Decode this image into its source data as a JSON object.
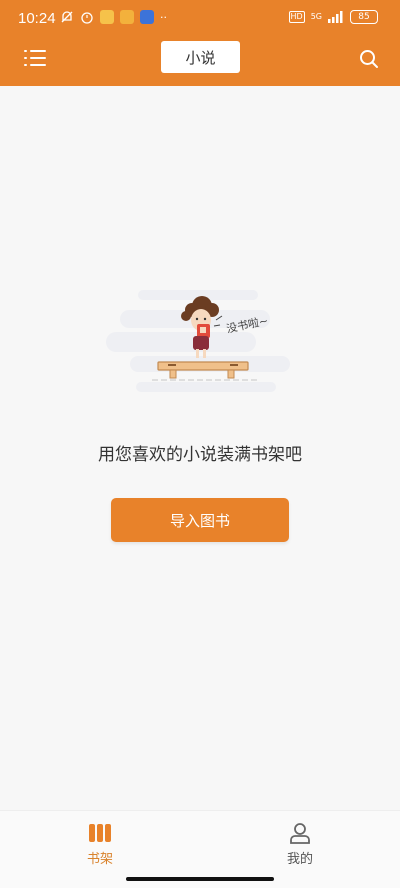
{
  "status_bar": {
    "time": "10:24",
    "network": "5G",
    "hd": "HD",
    "battery": "85"
  },
  "app_bar": {
    "title": "小说",
    "menu_icon": "menu-icon",
    "search_icon": "search-icon"
  },
  "empty_state": {
    "bubble_text": "没书啦~",
    "message": "用您喜欢的小说装满书架吧",
    "import_button_label": "导入图书"
  },
  "bottom_nav": {
    "items": [
      {
        "label": "书架",
        "icon": "bookshelf-icon",
        "active": true
      },
      {
        "label": "我的",
        "icon": "profile-icon",
        "active": false
      }
    ]
  },
  "colors": {
    "accent": "#e8822a",
    "active_label": "#d9822b",
    "inactive_label": "#555555"
  }
}
